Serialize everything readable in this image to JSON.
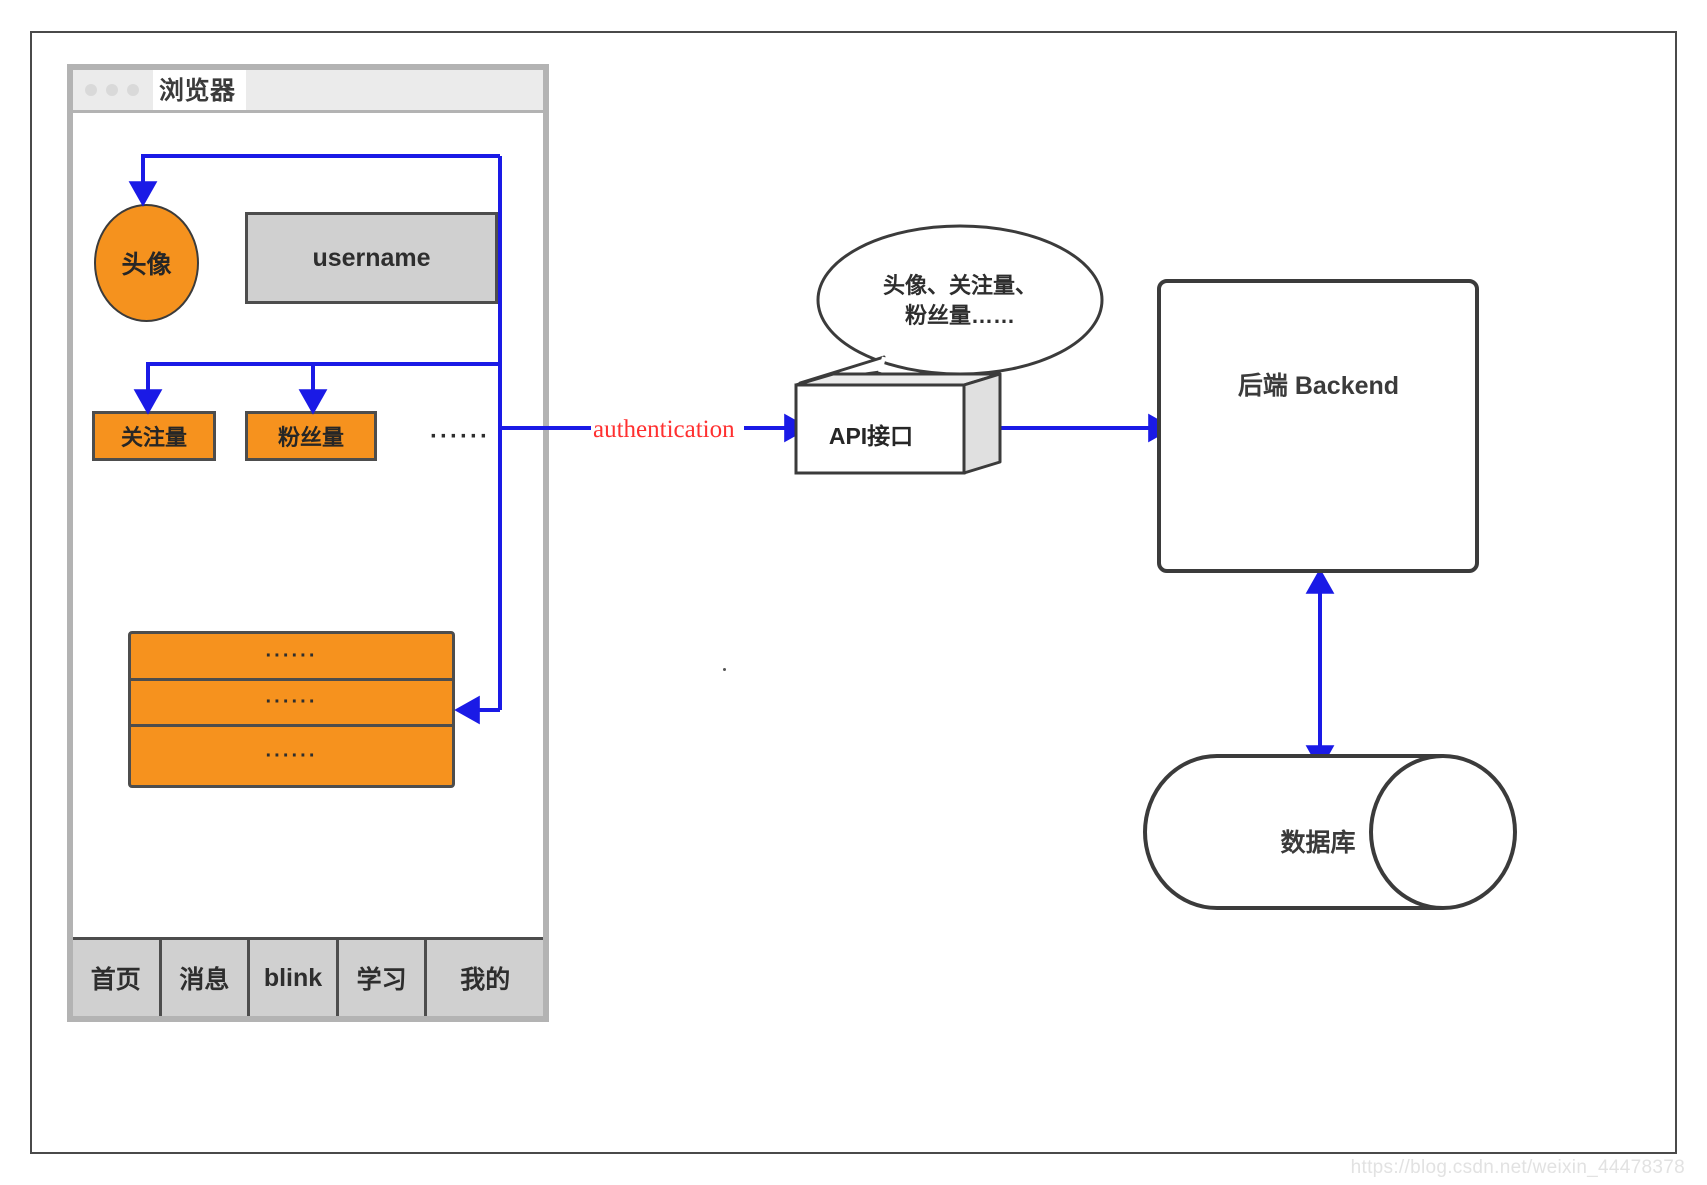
{
  "browser": {
    "title": "浏览器",
    "window_dots": [
      "dot",
      "dot",
      "dot"
    ]
  },
  "profile": {
    "avatar_label": "头像",
    "username_label": "username",
    "stats": [
      {
        "label": "关注量"
      },
      {
        "label": "粉丝量"
      }
    ],
    "stats_more": "······"
  },
  "feed": {
    "rows": [
      {
        "text": "······"
      },
      {
        "text": "······"
      },
      {
        "text": "······"
      }
    ]
  },
  "tabbar": {
    "tabs": [
      {
        "label": "首页"
      },
      {
        "label": "消息"
      },
      {
        "label": "blink"
      },
      {
        "label": "学习"
      },
      {
        "label": "我的"
      }
    ]
  },
  "flow": {
    "auth_label": "authentication",
    "bubble_line1": "头像、关注量、",
    "bubble_line2": "粉丝量……",
    "api_label": "API接口",
    "backend_label": "后端 Backend",
    "database_label": "数据库"
  },
  "footer": {
    "watermark": "https://blog.csdn.net/weixin_44478378"
  },
  "colors": {
    "accent_orange": "#f6921e",
    "wire_blue": "#1a1ae6",
    "auth_red": "#ff3030",
    "stroke_dark": "#4d4d4d",
    "gray_fill": "#d0d0d0",
    "frame_gray": "#b3b3b3"
  }
}
